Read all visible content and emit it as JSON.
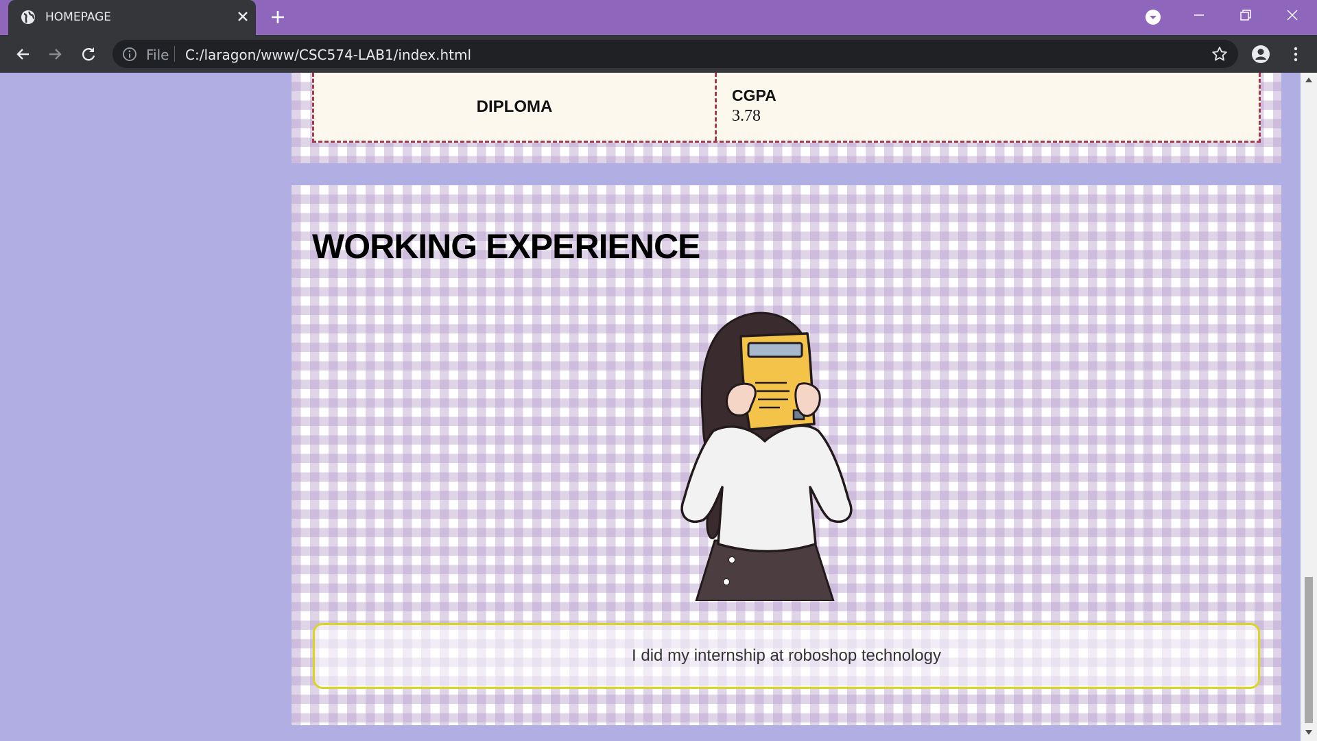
{
  "browser": {
    "tab_title": "HOMEPAGE",
    "scheme_label": "File",
    "url": "C:/laragon/www/CSC574-LAB1/index.html",
    "tab_bar_color": "#8e66bb"
  },
  "icons": {
    "favicon": "globe-icon",
    "close_tab": "close-icon",
    "new_tab": "plus-icon",
    "tab_search": "chevron-down-icon",
    "back": "back-arrow-icon",
    "forward": "forward-arrow-icon",
    "reload": "reload-icon",
    "site_info": "info-icon",
    "bookmark": "star-icon",
    "profile": "profile-icon",
    "menu": "menu-icon"
  },
  "education": {
    "level": "DIPLOMA",
    "label": "CGPA",
    "value": "3.78"
  },
  "work": {
    "title": "WORKING EXPERIENCE",
    "description": "I did my internship at roboshop technology"
  },
  "colors": {
    "page_background": "#b1aee4",
    "table_border": "#a43b4c",
    "description_border": "#d9d623"
  }
}
